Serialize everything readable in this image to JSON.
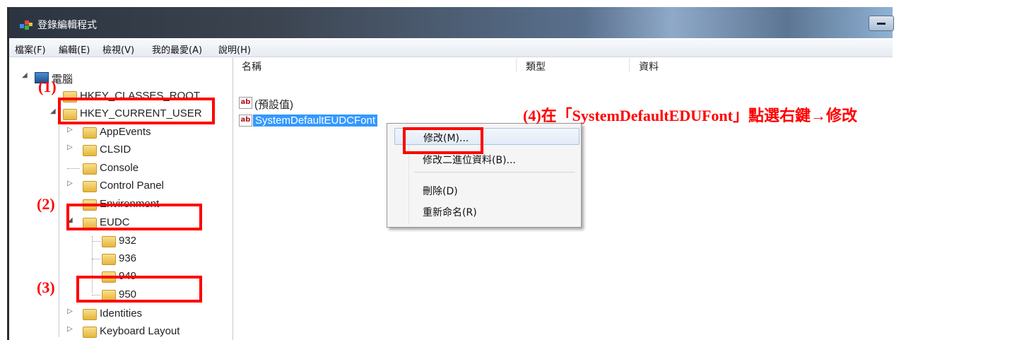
{
  "window": {
    "title": "登錄編輯程式"
  },
  "menu": [
    "檔案(F)",
    "編輯(E)",
    "檢視(V)",
    "我的最愛(A)",
    "說明(H)"
  ],
  "tree": {
    "computer": "電腦",
    "hkcr": "HKEY_CLASSES_ROOT",
    "hkcu": "HKEY_CURRENT_USER",
    "appevents": "AppEvents",
    "clsid": "CLSID",
    "console": "Console",
    "control_panel": "Control Panel",
    "environment": "Environment",
    "eudc": "EUDC",
    "k932": "932",
    "k936": "936",
    "k949": "949",
    "k950": "950",
    "identities": "Identities",
    "keyboard_layout": "Keyboard Layout"
  },
  "list": {
    "headers": {
      "name": "名稱",
      "type": "類型",
      "data": "資料"
    },
    "default_value": "(預設值)",
    "selected_value": "SystemDefaultEUDCFont",
    "value_icon": "ab"
  },
  "context_menu": {
    "modify": "修改(M)...",
    "modify_binary": "修改二進位資料(B)...",
    "delete": "刪除(D)",
    "rename": "重新命名(R)"
  },
  "annotations": {
    "step1": "(1)",
    "step2": "(2)",
    "step3": "(3)",
    "step4": "(4)在「SystemDefaultEDUFont」點選右鍵→修改",
    "color": "#ff0000"
  }
}
